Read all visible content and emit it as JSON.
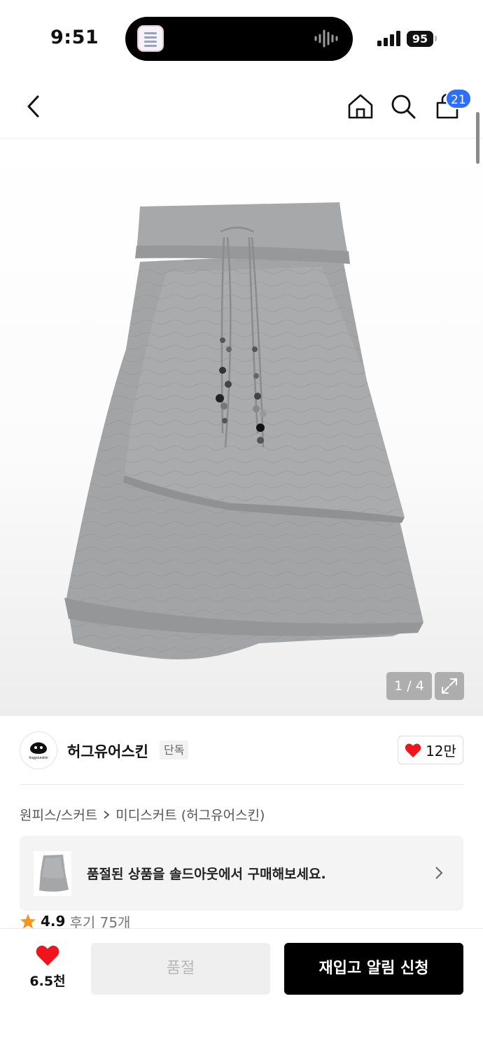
{
  "status": {
    "time": "9:51",
    "battery": "95"
  },
  "nav": {
    "back_icon": "chevron-left-icon",
    "home_icon": "home-icon",
    "search_icon": "search-icon",
    "cart_icon": "shopping-bag-icon",
    "cart_count": "21"
  },
  "gallery": {
    "counter": "1 / 4",
    "expand_icon": "expand-icon"
  },
  "brand": {
    "name": "허그유어스킨",
    "badge": "단독",
    "likes": "12만",
    "logo_text": "hugyourskin"
  },
  "breadcrumb": {
    "parent": "원피스/스커트",
    "current": "미디스커트 (허그유어스킨)"
  },
  "banner": {
    "text": "품절된 상품을 솔드아웃에서 구매해보세요."
  },
  "rating": {
    "score": "4.9",
    "reviews": "후기 75개"
  },
  "bottom": {
    "wish_count": "6.5천",
    "soldout_label": "품절",
    "restock_label": "재입고 알림 신청"
  },
  "colors": {
    "accent_blue": "#2f6ff5",
    "heart_red": "#f0151d",
    "star_orange": "#f7941d"
  }
}
